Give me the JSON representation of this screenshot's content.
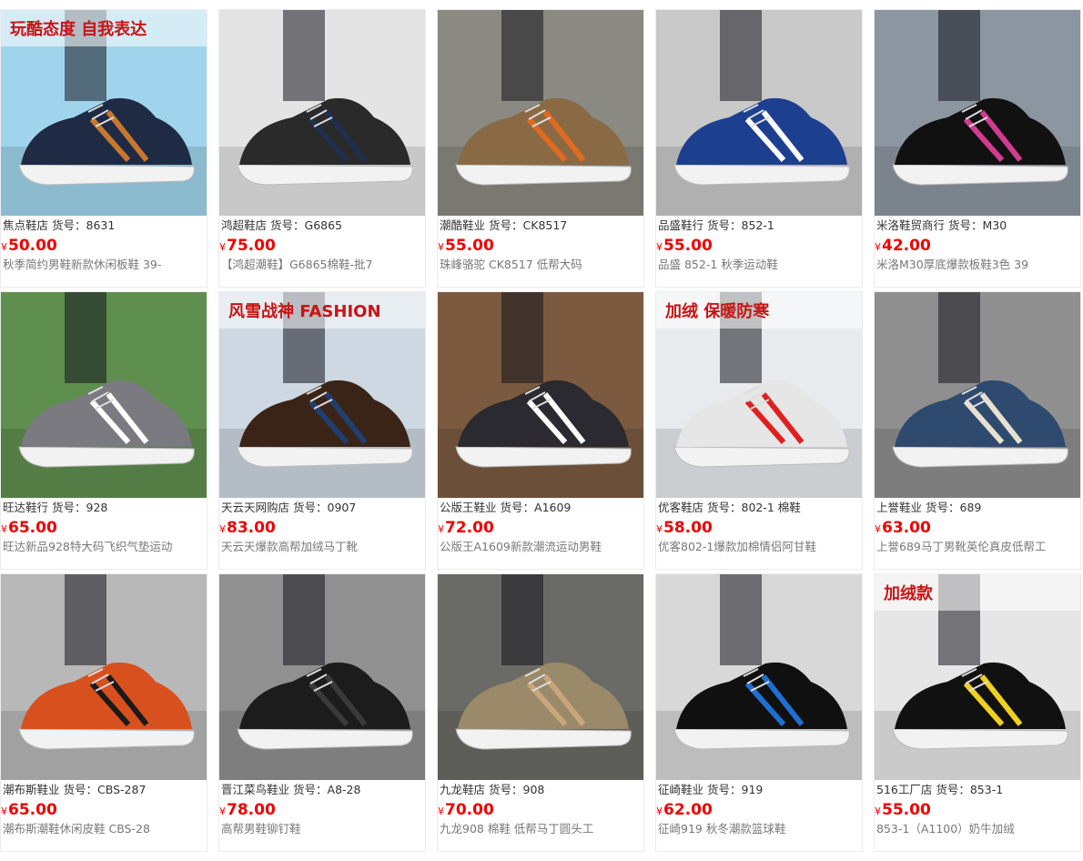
{
  "products": [
    {
      "shop": "焦点鞋店",
      "sku_label": "货号：",
      "sku": "8631",
      "currency": "¥",
      "price": "50.00",
      "title": "秋季简约男鞋新款休闲板鞋 39-",
      "bg": "#9fd4ec",
      "shoe": "#1f2a44",
      "accent": "#c8782e",
      "overlay": "玩酷态度 自我表达",
      "image_icon": "casual-shoe-icon"
    },
    {
      "shop": "鸿超鞋店",
      "sku_label": "货号：",
      "sku": "G6865",
      "currency": "¥",
      "price": "75.00",
      "title": "【鸿超潮鞋】G6865棉鞋-批7",
      "bg": "#e4e4e4",
      "shoe": "#2a2a2a",
      "accent": "#1f2f4f",
      "overlay": "",
      "image_icon": "boot-icon"
    },
    {
      "shop": "潮酷鞋业",
      "sku_label": "货号：",
      "sku": "CK8517",
      "currency": "¥",
      "price": "55.00",
      "title": "珠峰骆驼 CK8517 低帮大码",
      "bg": "#8a8a82",
      "shoe": "#8a6a45",
      "accent": "#e06a20",
      "overlay": "",
      "image_icon": "hiking-shoe-icon"
    },
    {
      "shop": "品盛鞋行",
      "sku_label": "货号：",
      "sku": "852-1",
      "currency": "¥",
      "price": "55.00",
      "title": "品盛 852-1 秋季运动鞋",
      "bg": "#c9c9c9",
      "shoe": "#1d3f8f",
      "accent": "#ffffff",
      "overlay": "",
      "image_icon": "running-shoe-icon"
    },
    {
      "shop": "米洛鞋贸商行",
      "sku_label": "货号：",
      "sku": "M30",
      "currency": "¥",
      "price": "42.00",
      "title": "米洛M30厚底爆款板鞋3色 39",
      "bg": "#8c96a0",
      "shoe": "#111111",
      "accent": "#d23b8f",
      "overlay": "",
      "image_icon": "sneaker-icon"
    },
    {
      "shop": "旺达鞋行",
      "sku_label": "货号：",
      "sku": "928",
      "currency": "¥",
      "price": "65.00",
      "title": "旺达新品928特大码飞织气垫运动",
      "bg": "#5f8f4e",
      "shoe": "#7a7a80",
      "accent": "#ffffff",
      "overlay": "",
      "image_icon": "air-cushion-shoe-icon"
    },
    {
      "shop": "天云天网购店",
      "sku_label": "货号：",
      "sku": "0907",
      "currency": "¥",
      "price": "83.00",
      "title": "天云天爆款高帮加绒马丁靴",
      "bg": "#cdd8e2",
      "shoe": "#3a2418",
      "accent": "#1f3f6f",
      "overlay": "风雪战神 FASHION",
      "image_icon": "martin-boot-icon"
    },
    {
      "shop": "公版王鞋业",
      "sku_label": "货号：",
      "sku": "A1609",
      "currency": "¥",
      "price": "72.00",
      "title": "公版王A1609新款潮流运动男鞋",
      "bg": "#7c5a40",
      "shoe": "#2a2a30",
      "accent": "#ffffff",
      "overlay": "",
      "image_icon": "sport-shoe-icon"
    },
    {
      "shop": "优客鞋店",
      "sku_label": "货号：",
      "sku": "802-1 棉鞋",
      "currency": "¥",
      "price": "58.00",
      "title": "优客802-1爆款加棉情侣阿甘鞋",
      "bg": "#e8eaee",
      "shoe": "#e6e6e6",
      "accent": "#e02020",
      "overlay": "加绒 保暖防寒",
      "image_icon": "forrest-gump-shoe-icon"
    },
    {
      "shop": "上誉鞋业",
      "sku_label": "货号：",
      "sku": "689",
      "currency": "¥",
      "price": "63.00",
      "title": "上誉689马丁男靴英伦真皮低帮工",
      "bg": "#8f8f8f",
      "shoe": "#2f4a6f",
      "accent": "#e8e0d0",
      "overlay": "",
      "image_icon": "leather-shoe-icon"
    },
    {
      "shop": "潮布斯鞋业",
      "sku_label": "货号：",
      "sku": "CBS-287",
      "currency": "¥",
      "price": "65.00",
      "title": "潮布斯潮鞋休闲皮鞋 CBS-28",
      "bg": "#b8b8b8",
      "shoe": "#d8501e",
      "accent": "#1a1a1a",
      "overlay": "",
      "image_icon": "loafer-icon"
    },
    {
      "shop": "晋江菜鸟鞋业",
      "sku_label": "货号：",
      "sku": "A8-28",
      "currency": "¥",
      "price": "78.00",
      "title": "高帮男鞋铆钉鞋",
      "bg": "#909090",
      "shoe": "#1c1c1c",
      "accent": "#3a3a3a",
      "overlay": "",
      "image_icon": "high-top-shoe-icon"
    },
    {
      "shop": "九龙鞋店",
      "sku_label": "货号：",
      "sku": "908",
      "currency": "¥",
      "price": "70.00",
      "title": "九龙908 棉鞋 低帮马丁圆头工",
      "bg": "#6a6a66",
      "shoe": "#9a8a6a",
      "accent": "#caa57a",
      "overlay": "",
      "image_icon": "work-boot-icon"
    },
    {
      "shop": "征崎鞋业",
      "sku_label": "货号：",
      "sku": "919",
      "currency": "¥",
      "price": "62.00",
      "title": "征崎919 秋冬潮款篮球鞋",
      "bg": "#d8d8d8",
      "shoe": "#101010",
      "accent": "#1f6fd0",
      "overlay": "",
      "image_icon": "basketball-shoe-icon"
    },
    {
      "shop": "516工厂店",
      "sku_label": "货号：",
      "sku": "853-1",
      "currency": "¥",
      "price": "55.00",
      "title": "853-1（A1100）奶牛加绒",
      "bg": "#e6e6e6",
      "shoe": "#111111",
      "accent": "#f0d020",
      "overlay": "加绒款",
      "image_icon": "cow-pattern-sneaker-icon"
    }
  ]
}
